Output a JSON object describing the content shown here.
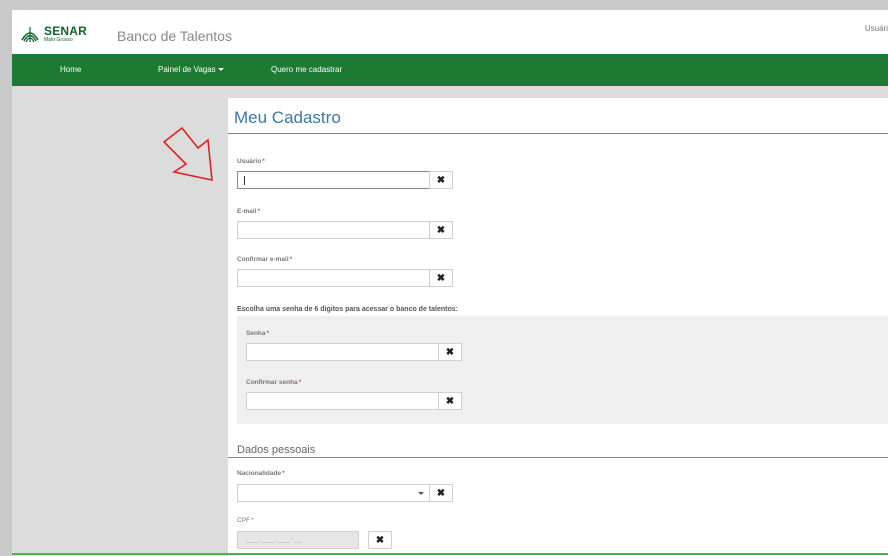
{
  "header": {
    "logo_name": "SENAR",
    "logo_sub": "Mato Grosso",
    "site_title": "Banco de Talentos",
    "user_link": "Usuári"
  },
  "nav": {
    "home": "Home",
    "vagas": "Painel de Vagas",
    "cadastrar": "Quero me cadastrar"
  },
  "form": {
    "title": "Meu Cadastro",
    "usuario_label": "Usuário",
    "email_label": "E-mail",
    "confirm_email_label": "Confirmar e-mail",
    "password_section": "Escolha uma senha de 6 dígitos para acessar o banco de talentos:",
    "senha_label": "Senha",
    "confirm_senha_label": "Confirmar senha",
    "personal_section": "Dados pessoais",
    "nacionalidade_label": "Nacionalidade",
    "cpf_label": "CPF",
    "cpf_mask": "___.___.___-__",
    "required_mark": "*",
    "clear_glyph": "✖"
  },
  "colors": {
    "nav_green": "#1c7a33",
    "title_blue": "#3b78a8",
    "rule_green": "#4caf50",
    "arrow_red": "#e02020"
  }
}
